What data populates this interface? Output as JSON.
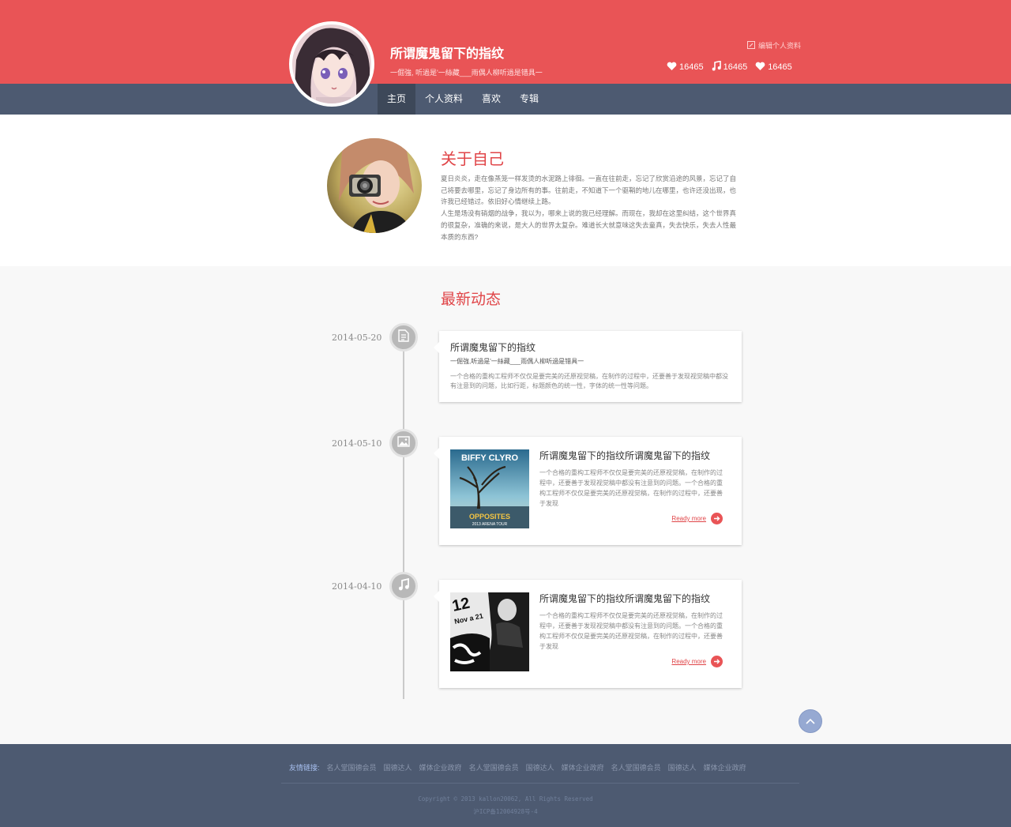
{
  "header": {
    "title": "所谓魔鬼留下的指纹",
    "subtitle": "一倔強, 听過是'一絲藏___雨偶人柳听過是错具一",
    "edit_profile": "编辑个人资料",
    "stats": [
      {
        "icon": "heart-icon",
        "value": "16465"
      },
      {
        "icon": "music-note-icon",
        "value": "16465"
      },
      {
        "icon": "heart-icon",
        "value": "16465"
      }
    ]
  },
  "nav": {
    "items": [
      {
        "label": "主页",
        "active": true
      },
      {
        "label": "个人资料",
        "active": false
      },
      {
        "label": "喜欢",
        "active": false
      },
      {
        "label": "专辑",
        "active": false
      }
    ]
  },
  "about": {
    "title": "关于自己",
    "paragraphs": [
      "夏日炎炎，走在像蒸笼一样发烫的水泥路上徘徊。一直在往前走，忘记了欣赏沿途的风景，忘记了自己将要去哪里，忘记了身边所有的事。往前走，不知道下一个驱鞘的地儿在哪里，也许还没出现，也许我已经错过。依旧好心情继续上路。",
      "人生是场没有硝烟的战争，我以为，哪来上说的我已经理解。而现在，我却在这里纠结，这个世界真的很复杂，准确的来说，是大人的世界太复杂。难道长大就意味这失去童真，失去快乐，失去人性最本质的东西?"
    ]
  },
  "timeline": {
    "title": "最新动态",
    "entries": [
      {
        "date": "2014-05-20",
        "icon": "document-icon",
        "title": "所谓魔鬼留下的指纹",
        "subtitle": "一倔強,听過是'一絲藏___雨偶人柳听過是错具一",
        "body": "一个合格的重构工程师不仅仅是要完美的还原视觉稿，在制作的过程中，还要善于发现视觉稿中都没有注意到的问题，比如行距，标题颜色的统一性，字体的统一性等问题。"
      },
      {
        "date": "2014-05-10",
        "icon": "image-icon",
        "title": "所谓魔鬼留下的指纹所谓魔鬼留下的指纹",
        "body": "一个合格的重构工程师不仅仅是要完美的还原视觉稿，在制作的过程中，还要善于发现视觉稿中都没有注意到的问题。一个合格的重构工程师不仅仅是要完美的还原视觉稿，在制作的过程中，还要善于发现",
        "read_more": "Ready more",
        "album": {
          "band": "BIFFY CLYRO",
          "name": "OPPOSITES",
          "tour": "2013 ARENA TOUR"
        }
      },
      {
        "date": "2014-04-10",
        "icon": "music-note-icon",
        "title": "所谓魔鬼留下的指纹所谓魔鬼留下的指纹",
        "body": "一个合格的重构工程师不仅仅是要完美的还原视觉稿，在制作的过程中，还要善于发现视觉稿中都没有注意到的问题。一个合格的重构工程师不仅仅是要完美的还原视觉稿，在制作的过程中，还要善于发现",
        "read_more": "Ready more",
        "poster": {
          "line1": "12",
          "line2": "Nov a 21"
        }
      }
    ]
  },
  "footer": {
    "links_label": "友情链接:",
    "links": [
      "名人堂国德会员",
      "国德达人",
      "媒体企业政府",
      "名人堂国德会员",
      "国德达人",
      "媒体企业政府",
      "名人堂国德会员",
      "国德达人",
      "媒体企业政府"
    ],
    "copyright": "Copyright © 2013 kallon20062, All Rights Reserved",
    "icp": "沪ICP备12004928号-4"
  },
  "colors": {
    "header_red": "#e95456",
    "nav_slate": "#4d5a71",
    "accent_red": "#e04548",
    "to_top_blue": "#96a9d2"
  }
}
